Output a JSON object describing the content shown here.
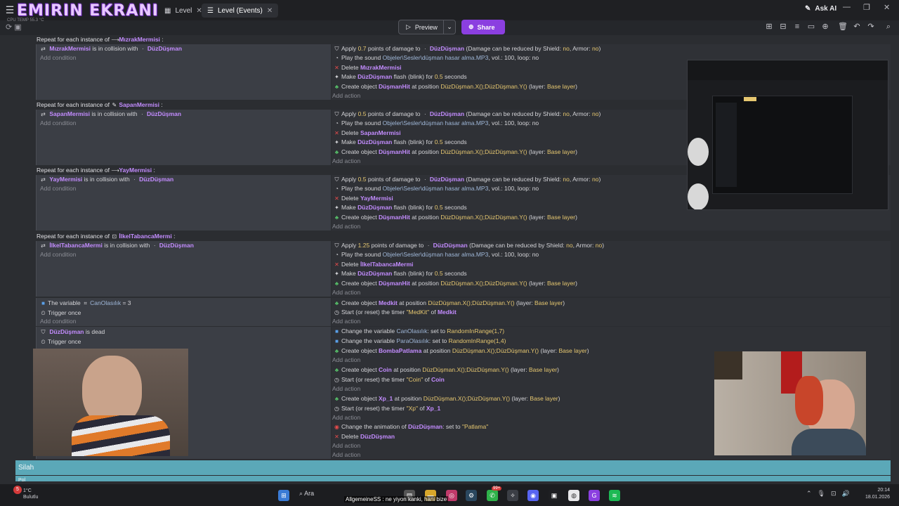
{
  "brand": "EMIRIN EKRANI",
  "tabs": [
    {
      "label": "Level"
    },
    {
      "label": "Level (Events)"
    }
  ],
  "topbar": {
    "ask_ai": "Ask AI"
  },
  "toolbar": {
    "preview_label": "Preview",
    "share_label": "Share"
  },
  "overlay_weather": {
    "label": "CPU TEMP",
    "value": "55.3 °C"
  },
  "events": [
    {
      "header_prefix": "Repeat for each instance of",
      "header_obj": "MızrakMermisi",
      "cond_obj": "MızrakMermisi",
      "cond_text": "is in collision with",
      "cond_target": "DüzDüşman",
      "add_condition": "Add condition",
      "damage": "0.7",
      "delete_obj": "MızrakMermisi"
    },
    {
      "header_prefix": "Repeat for each instance of",
      "header_obj": "SapanMermisi",
      "cond_obj": "SapanMermisi",
      "cond_text": "is in collision with",
      "cond_target": "DüzDüşman",
      "add_condition": "Add condition",
      "damage": "0.5",
      "delete_obj": "SapanMermisi"
    },
    {
      "header_prefix": "Repeat for each instance of",
      "header_obj": "YayMermisi",
      "cond_obj": "YayMermisi",
      "cond_text": "is in collision with",
      "cond_target": "DüzDüşman",
      "add_condition": "Add condition",
      "damage": "0.5",
      "delete_obj": "YayMermisi"
    },
    {
      "header_prefix": "Repeat for each instance of",
      "header_obj": "İlkelTabancaMermi",
      "cond_obj": "İlkelTabancaMermi",
      "cond_text": "is in collision with",
      "cond_target": "DüzDüşman",
      "add_condition": "Add condition",
      "damage": "1.25",
      "delete_obj": "İlkelTabancaMermi"
    }
  ],
  "actions_common": {
    "apply_prefix": "Apply",
    "apply_mid": "points of damage to",
    "enemy": "DüzDüşman",
    "apply_suffix_a": "(Damage can be reduced by Shield:",
    "no": "no",
    "armor": ", Armor:",
    "close_paren": ")",
    "play_sound": "Play the sound",
    "sound_path": "Objeler\\Sesler\\düşman hasar alma.MP3",
    "sound_suffix": ", vol.: 100, loop: no",
    "delete": "Delete",
    "make": "Make",
    "flash_text": "flash (blink) for",
    "flash_val": "0.5",
    "seconds": "seconds",
    "create_object": "Create object",
    "hit_obj": "DüşmanHit",
    "at_position": "at position",
    "position_expr": "DüzDüşman.X();DüzDüşman.Y()",
    "layer_prefix": "(layer:",
    "layer_name": "Base layer",
    "add_action": "Add action"
  },
  "medkit_event": {
    "cond_text": "The variable",
    "var_name": "CanOlasılık",
    "cond_value": "= 3",
    "trigger_once": "Trigger once",
    "add_condition": "Add condition",
    "create_obj": "Medkit",
    "timer_text": "Start (or reset) the timer",
    "timer_name": "\"MedKit\"",
    "of": "of",
    "timer_obj": "Medkit"
  },
  "dead_event": {
    "enemy": "DüzDüşman",
    "is_dead": "is dead",
    "trigger_once": "Trigger once",
    "change_var": "Change the variable",
    "var1": "CanOlasılık",
    "set_to": ": set to",
    "expr1": "RandomInRange(1,7)",
    "var2": "ParaOlasılık",
    "expr2": "RandomInRange(1,4)",
    "bomb_obj": "BombaPatlama",
    "coin_obj": "Coin",
    "coin_timer": "\"Coin\"",
    "xp_obj": "Xp_1",
    "xp_timer": "\"Xp\"",
    "change_anim": "Change the animation of",
    "anim_value": "\"Patlama\""
  },
  "group_bar": {
    "label": "Silah",
    "sub_label": "Pol"
  },
  "taskbar": {
    "weather_temp": "1°C",
    "weather_desc": "Bulutlu",
    "search": "Ara",
    "notif_count": "5",
    "badge_99": "99+",
    "time": "20:14",
    "date": "18.01.2026"
  },
  "subtitle": "AllgemeineSS : ne yiyon kanki, hani bize"
}
